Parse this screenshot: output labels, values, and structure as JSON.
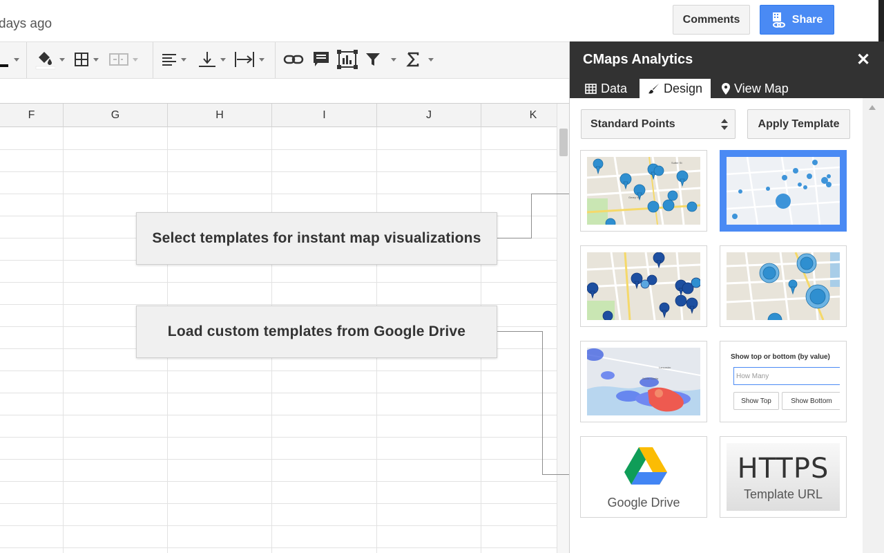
{
  "header": {
    "last_edit": "days ago",
    "comments_label": "Comments",
    "share_label": "Share"
  },
  "grid": {
    "columns": [
      "F",
      "G",
      "H",
      "I",
      "J",
      "K"
    ]
  },
  "callouts": {
    "templates": "Select templates for instant map visualizations",
    "custom": "Load custom templates from Google Drive"
  },
  "sidebar": {
    "title": "CMaps Analytics",
    "tabs": [
      {
        "label": "Data",
        "icon": "table-icon"
      },
      {
        "label": "Design",
        "icon": "brush-icon",
        "active": true
      },
      {
        "label": "View Map",
        "icon": "map-marker-icon"
      }
    ],
    "select_value": "Standard Points",
    "apply_label": "Apply Template",
    "top_bottom": {
      "title": "Show top or bottom (by value)",
      "placeholder": "How Many",
      "show_top": "Show Top",
      "show_bottom": "Show Bottom"
    },
    "google_drive_label": "Google Drive",
    "https_big": "HTTPS",
    "https_small": "Template URL"
  },
  "colors": {
    "share_blue": "#4a8af4",
    "sidebar_dark": "#323232",
    "selected_tile": "#4a8af4"
  }
}
